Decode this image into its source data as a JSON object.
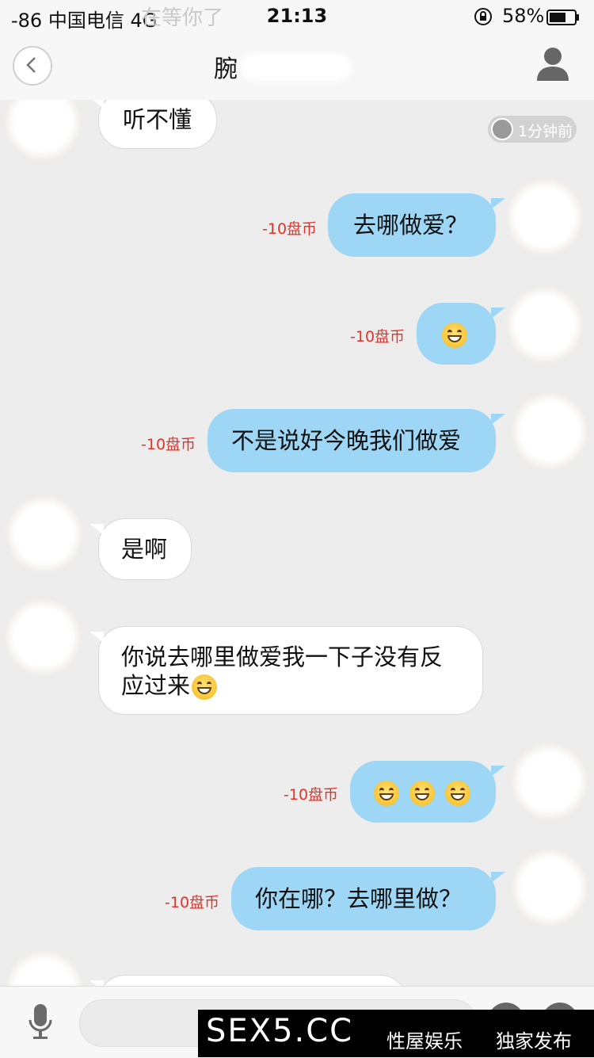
{
  "status_bar": {
    "carrier": "-86 中国电信   4G",
    "ghost_text": "在等你了",
    "time": "21:13",
    "battery": "58%"
  },
  "nav": {
    "title": "腕"
  },
  "timestamp": "1分钟前",
  "messages": [
    {
      "side": "left",
      "text": "听不懂"
    },
    {
      "side": "right",
      "text": "去哪做爱？",
      "cost": "-10盘币"
    },
    {
      "side": "right",
      "emoji_count": 1,
      "cost": "-10盘币"
    },
    {
      "side": "right",
      "text": "不是说好今晚我们做爱",
      "cost": "-10盘币"
    },
    {
      "side": "left",
      "text": "是啊"
    },
    {
      "side": "left",
      "text_line1": "你说去哪里做爱我一下子没有反",
      "text_line2": "应过来"
    },
    {
      "side": "right",
      "emoji_count": 3,
      "cost": "-10盘币"
    },
    {
      "side": "right",
      "text": "你在哪？去哪里做？",
      "cost": "-10盘币"
    }
  ],
  "watermark": {
    "site": "SEX5.CC",
    "tag1": "性屋娱乐",
    "tag2": "独家发布"
  },
  "colors": {
    "background": "#ededed",
    "sent_bubble": "#9ed6f5",
    "received_bubble": "#ffffff",
    "cost_text": "#e0342a"
  }
}
